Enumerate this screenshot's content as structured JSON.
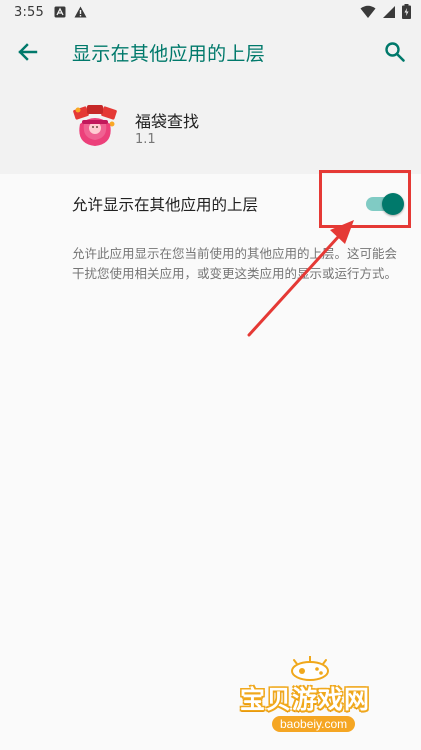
{
  "status_bar": {
    "time": "3:55",
    "left_icons": [
      "notification-a-icon",
      "warning-icon"
    ],
    "right_icons": [
      "wifi-icon",
      "signal-icon",
      "battery-icon"
    ]
  },
  "app_bar": {
    "title": "显示在其他应用的上层",
    "back_icon": "arrow-left-icon",
    "search_icon": "search-icon"
  },
  "app_info": {
    "name": "福袋查找",
    "version": "1.1"
  },
  "setting": {
    "label": "允许显示在其他应用的上层",
    "enabled": true,
    "description": "允许此应用显示在您当前使用的其他应用的上层。这可能会干扰您使用相关应用，或变更这类应用的显示或运行方式。"
  },
  "watermark": {
    "text": "宝贝游戏网",
    "domain": "baobeiy.com"
  },
  "colors": {
    "accent": "#00796b",
    "accent_light": "#80cbc4",
    "annotation": "#e53935",
    "watermark": "#f5a623"
  }
}
